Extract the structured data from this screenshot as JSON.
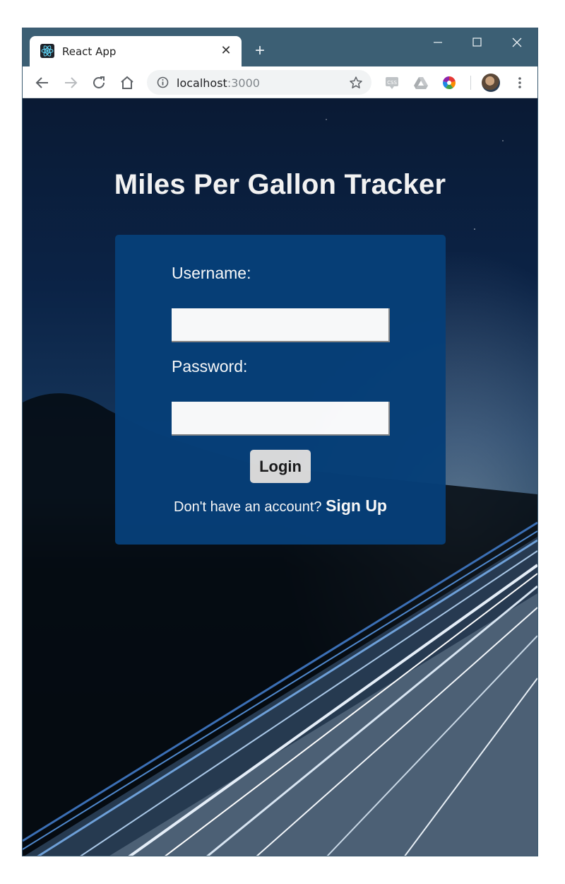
{
  "browser": {
    "tab": {
      "title": "React App",
      "favicon": "react-logo-icon"
    },
    "address_bar": {
      "host": "localhost",
      "port": ":3000"
    },
    "accent_color": "#3c5f74"
  },
  "page": {
    "title": "Miles Per Gallon Tracker",
    "form": {
      "username_label": "Username:",
      "username_value": "",
      "password_label": "Password:",
      "password_value": "",
      "login_label": "Login",
      "signup_prompt": "Don't have an account?",
      "signup_label": "Sign Up"
    },
    "card_color": "#063f78"
  }
}
